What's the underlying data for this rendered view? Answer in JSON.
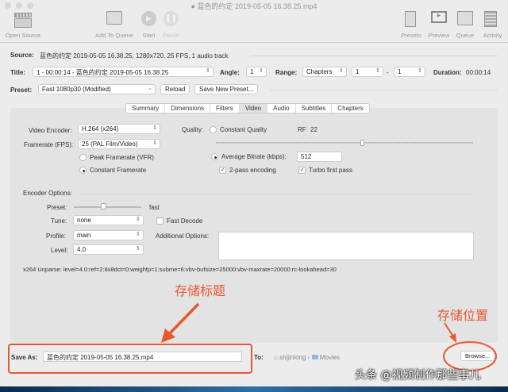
{
  "window": {
    "title": "蓝色的约定 2019-05-05 16.38.25.mp4"
  },
  "toolbar": {
    "open_source": "Open Source",
    "add_to_queue": "Add To Queue",
    "start": "Start",
    "pause": "Pause",
    "presets": "Presets",
    "preview": "Preview",
    "queue": "Queue",
    "activity": "Activity"
  },
  "source": {
    "label": "Source:",
    "value": "蓝色的约定 2019-05-05 16.38.25, 1280x720, 25 FPS, 1 audio track"
  },
  "title_row": {
    "label": "Title:",
    "value": "1 - 00:00:14 - 蓝色的约定 2019-05-05 16.38.25",
    "angle_label": "Angle:",
    "angle": "1",
    "range_label": "Range:",
    "range_type": "Chapters",
    "range_start": "1",
    "range_sep": "-",
    "range_end": "1",
    "duration_label": "Duration:",
    "duration": "00:00:14"
  },
  "preset_row": {
    "label": "Preset:",
    "value": "Fast 1080p30 (Modified)",
    "reload": "Reload",
    "save_new": "Save New Preset..."
  },
  "tabs": [
    "Summary",
    "Dimensions",
    "Filters",
    "Video",
    "Audio",
    "Subtitles",
    "Chapters"
  ],
  "video": {
    "encoder_label": "Video Encoder:",
    "encoder": "H.264 (x264)",
    "framerate_label": "Framerate (FPS):",
    "framerate": "25 (PAL Film/Video)",
    "peak_framerate": "Peak Framerate (VFR)",
    "constant_framerate": "Constant Framerate",
    "quality_label": "Quality:",
    "constant_quality": "Constant Quality",
    "rf_label": "RF",
    "rf_value": "22",
    "rf_slider_fraction": 0.57,
    "avg_bitrate_label": "Average Bitrate (kbps):",
    "avg_bitrate": "512",
    "two_pass": "2-pass encoding",
    "turbo": "Turbo first pass",
    "encoder_options_label": "Encoder Options:",
    "preset_label": "Preset:",
    "preset_value": "fast",
    "preset_slider_fraction": 0.45,
    "tune_label": "Tune:",
    "tune": "none",
    "fast_decode": "Fast Decode",
    "profile_label": "Profile:",
    "profile": "main",
    "additional_label": "Additional Options:",
    "level_label": "Level:",
    "level": "4.0",
    "unparse": "x264 Unparse: level=4.0:ref=2:8x8dct=0:weightp=1:subme=6:vbv-bufsize=25000:vbv-maxrate=20000:rc-lookahead=30"
  },
  "save": {
    "label": "Save As:",
    "value": "蓝色的约定 2019-05-05 16.38.25.mp4",
    "to_label": "To:",
    "user": "shijinlong",
    "folder": "Movies",
    "browse": "Browse..."
  },
  "annotations": {
    "title_note": "存储标题",
    "location_note": "存储位置",
    "accent": "#e8582f"
  },
  "watermark": "头条 @视频制作那些事儿"
}
